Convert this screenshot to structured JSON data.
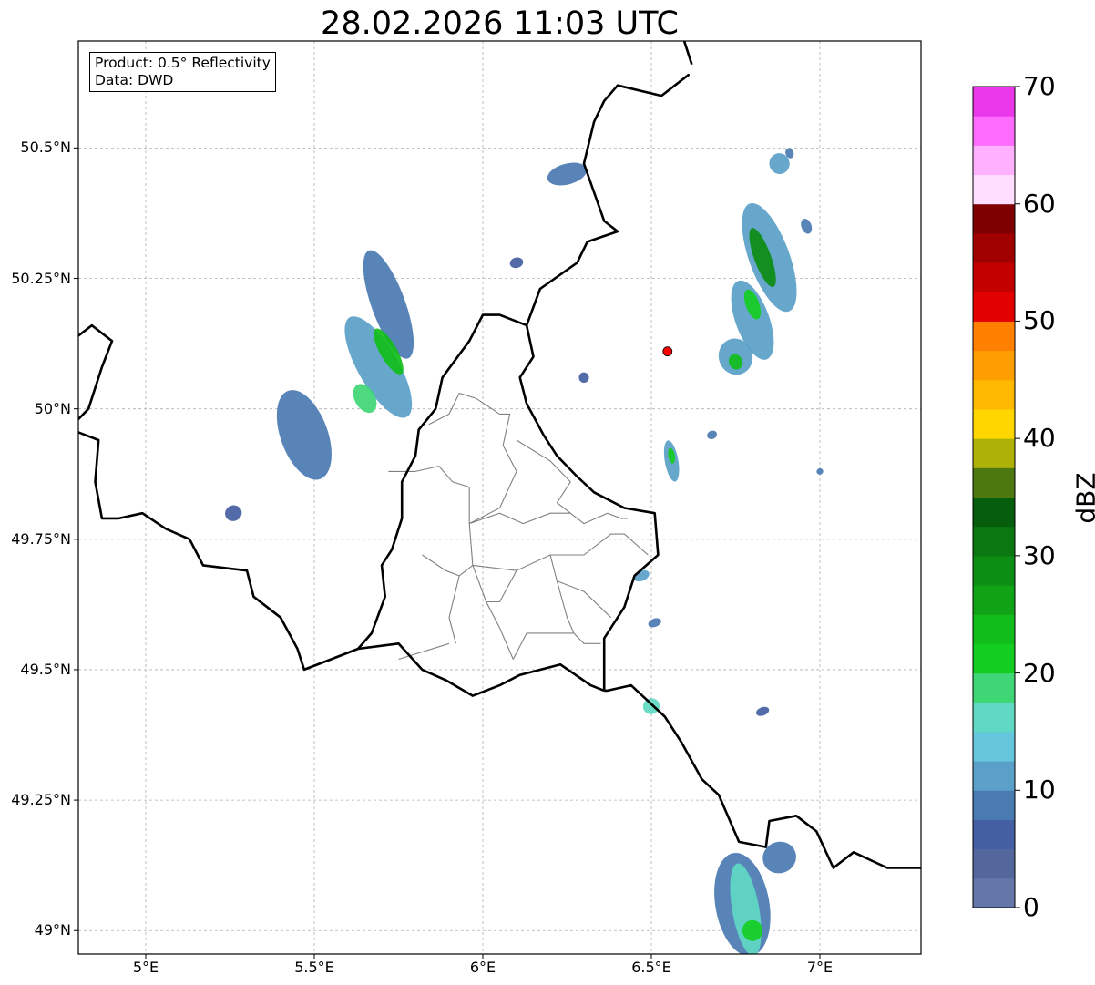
{
  "title": "28.02.2026 11:03 UTC",
  "product_box": {
    "line1": "Product: 0.5° Reflectivity",
    "line2": "Data: DWD"
  },
  "map": {
    "lon_range": [
      4.8,
      7.3
    ],
    "lat_range": [
      48.955,
      50.705
    ],
    "lat_ticks": [
      {
        "value": 50.5,
        "label": "50.5°N"
      },
      {
        "value": 50.25,
        "label": "50.25°N"
      },
      {
        "value": 50.0,
        "label": "50°N"
      },
      {
        "value": 49.75,
        "label": "49.75°N"
      },
      {
        "value": 49.5,
        "label": "49.5°N"
      },
      {
        "value": 49.25,
        "label": "49.25°N"
      },
      {
        "value": 49.0,
        "label": "49°N"
      }
    ],
    "lon_ticks": [
      {
        "value": 5.0,
        "label": "5°E"
      },
      {
        "value": 5.5,
        "label": "5.5°E"
      },
      {
        "value": 6.0,
        "label": "6°E"
      },
      {
        "value": 6.5,
        "label": "6.5°E"
      },
      {
        "value": 7.0,
        "label": "7°E"
      }
    ],
    "grid": true,
    "radar_site": {
      "lon": 6.548,
      "lat": 50.11,
      "color": "#ff0000"
    },
    "echoes": [
      {
        "lon": 5.47,
        "lat": 49.95,
        "rx": 0.07,
        "ry": 0.09,
        "angle": -20,
        "dbz": 8
      },
      {
        "lon": 5.72,
        "lat": 50.2,
        "rx": 0.05,
        "ry": 0.11,
        "angle": -20,
        "dbz": 9
      },
      {
        "lon": 5.69,
        "lat": 50.08,
        "rx": 0.06,
        "ry": 0.11,
        "angle": -30,
        "dbz": 12
      },
      {
        "lon": 5.72,
        "lat": 50.11,
        "rx": 0.025,
        "ry": 0.05,
        "angle": -30,
        "dbz": 24
      },
      {
        "lon": 5.65,
        "lat": 50.02,
        "rx": 0.03,
        "ry": 0.03,
        "angle": -30,
        "dbz": 18
      },
      {
        "lon": 5.26,
        "lat": 49.8,
        "rx": 0.025,
        "ry": 0.015,
        "angle": -20,
        "dbz": 7
      },
      {
        "lon": 6.25,
        "lat": 50.45,
        "rx": 0.06,
        "ry": 0.02,
        "angle": -15,
        "dbz": 8
      },
      {
        "lon": 6.1,
        "lat": 50.28,
        "rx": 0.02,
        "ry": 0.01,
        "angle": -15,
        "dbz": 6
      },
      {
        "lon": 6.3,
        "lat": 50.06,
        "rx": 0.015,
        "ry": 0.01,
        "angle": -15,
        "dbz": 6
      },
      {
        "lon": 6.85,
        "lat": 50.29,
        "rx": 0.06,
        "ry": 0.11,
        "angle": -20,
        "dbz": 10
      },
      {
        "lon": 6.83,
        "lat": 50.29,
        "rx": 0.025,
        "ry": 0.06,
        "angle": -20,
        "dbz": 28
      },
      {
        "lon": 6.8,
        "lat": 50.17,
        "rx": 0.05,
        "ry": 0.08,
        "angle": -20,
        "dbz": 10
      },
      {
        "lon": 6.8,
        "lat": 50.2,
        "rx": 0.02,
        "ry": 0.03,
        "angle": -20,
        "dbz": 22
      },
      {
        "lon": 6.75,
        "lat": 50.1,
        "rx": 0.05,
        "ry": 0.035,
        "angle": -20,
        "dbz": 11
      },
      {
        "lon": 6.75,
        "lat": 50.09,
        "rx": 0.02,
        "ry": 0.015,
        "angle": -20,
        "dbz": 24
      },
      {
        "lon": 6.88,
        "lat": 50.47,
        "rx": 0.03,
        "ry": 0.02,
        "angle": -20,
        "dbz": 11
      },
      {
        "lon": 6.91,
        "lat": 50.49,
        "rx": 0.012,
        "ry": 0.01,
        "angle": -20,
        "dbz": 8
      },
      {
        "lon": 6.96,
        "lat": 50.35,
        "rx": 0.015,
        "ry": 0.015,
        "angle": -20,
        "dbz": 8
      },
      {
        "lon": 6.56,
        "lat": 49.9,
        "rx": 0.02,
        "ry": 0.04,
        "angle": -10,
        "dbz": 12
      },
      {
        "lon": 6.56,
        "lat": 49.91,
        "rx": 0.01,
        "ry": 0.015,
        "angle": -10,
        "dbz": 22
      },
      {
        "lon": 6.47,
        "lat": 49.68,
        "rx": 0.025,
        "ry": 0.01,
        "angle": -20,
        "dbz": 11
      },
      {
        "lon": 6.51,
        "lat": 49.59,
        "rx": 0.02,
        "ry": 0.008,
        "angle": -20,
        "dbz": 8
      },
      {
        "lon": 6.5,
        "lat": 49.43,
        "rx": 0.025,
        "ry": 0.015,
        "angle": -20,
        "dbz": 16
      },
      {
        "lon": 6.83,
        "lat": 49.42,
        "rx": 0.02,
        "ry": 0.008,
        "angle": -20,
        "dbz": 7
      },
      {
        "lon": 6.68,
        "lat": 49.95,
        "rx": 0.015,
        "ry": 0.008,
        "angle": -20,
        "dbz": 9
      },
      {
        "lon": 7.0,
        "lat": 49.88,
        "rx": 0.01,
        "ry": 0.006,
        "angle": -20,
        "dbz": 8
      },
      {
        "lon": 6.77,
        "lat": 49.05,
        "rx": 0.08,
        "ry": 0.1,
        "angle": -10,
        "dbz": 9
      },
      {
        "lon": 6.78,
        "lat": 49.04,
        "rx": 0.04,
        "ry": 0.09,
        "angle": -10,
        "dbz": 15
      },
      {
        "lon": 6.88,
        "lat": 49.14,
        "rx": 0.05,
        "ry": 0.03,
        "angle": -20,
        "dbz": 8
      },
      {
        "lon": 6.8,
        "lat": 49.0,
        "rx": 0.03,
        "ry": 0.02,
        "angle": -10,
        "dbz": 21
      }
    ],
    "borders": [
      [
        [
          4.8,
          50.14
        ],
        [
          4.84,
          50.16
        ],
        [
          4.9,
          50.13
        ],
        [
          4.87,
          50.08
        ],
        [
          4.83,
          50.0
        ],
        [
          4.8,
          49.98
        ]
      ],
      [
        [
          4.8,
          49.955
        ],
        [
          4.86,
          49.94
        ],
        [
          4.85,
          49.86
        ],
        [
          4.87,
          49.79
        ],
        [
          4.92,
          49.79
        ],
        [
          4.99,
          49.8
        ],
        [
          5.06,
          49.77
        ],
        [
          5.13,
          49.75
        ],
        [
          5.17,
          49.7
        ],
        [
          5.3,
          49.69
        ],
        [
          5.32,
          49.64
        ],
        [
          5.4,
          49.6
        ],
        [
          5.45,
          49.54
        ],
        [
          5.47,
          49.5
        ],
        [
          5.55,
          49.52
        ],
        [
          5.63,
          49.54
        ],
        [
          5.75,
          49.55
        ],
        [
          5.82,
          49.5
        ],
        [
          5.89,
          49.48
        ],
        [
          5.97,
          49.45
        ],
        [
          6.05,
          49.47
        ],
        [
          6.11,
          49.49
        ],
        [
          6.23,
          49.51
        ],
        [
          6.32,
          49.47
        ],
        [
          6.36,
          49.46
        ]
      ],
      [
        [
          6.59,
          50.63
        ],
        [
          6.61,
          50.64
        ],
        [
          6.53,
          50.6
        ],
        [
          6.4,
          50.62
        ],
        [
          6.36,
          50.59
        ],
        [
          6.33,
          50.55
        ],
        [
          6.3,
          50.47
        ],
        [
          6.36,
          50.36
        ],
        [
          6.4,
          50.34
        ],
        [
          6.31,
          50.32
        ],
        [
          6.28,
          50.28
        ],
        [
          6.17,
          50.23
        ],
        [
          6.13,
          50.16
        ],
        [
          6.15,
          50.1
        ],
        [
          6.11,
          50.06
        ],
        [
          6.13,
          50.01
        ],
        [
          6.18,
          49.95
        ],
        [
          6.22,
          49.91
        ],
        [
          6.28,
          49.87
        ],
        [
          6.33,
          49.84
        ],
        [
          6.42,
          49.81
        ],
        [
          6.51,
          49.8
        ],
        [
          6.52,
          49.72
        ],
        [
          6.45,
          49.68
        ],
        [
          6.42,
          49.62
        ],
        [
          6.36,
          49.56
        ],
        [
          6.36,
          49.46
        ]
      ],
      [
        [
          6.59,
          50.72
        ],
        [
          6.62,
          50.66
        ]
      ],
      [
        [
          6.36,
          49.46
        ],
        [
          6.37,
          49.46
        ],
        [
          6.44,
          49.47
        ],
        [
          6.54,
          49.41
        ],
        [
          6.59,
          49.36
        ],
        [
          6.65,
          49.29
        ],
        [
          6.7,
          49.26
        ],
        [
          6.76,
          49.17
        ],
        [
          6.84,
          49.16
        ],
        [
          6.85,
          49.21
        ],
        [
          6.93,
          49.22
        ],
        [
          6.99,
          49.19
        ],
        [
          7.04,
          49.12
        ],
        [
          7.1,
          49.15
        ],
        [
          7.2,
          49.12
        ],
        [
          7.3,
          49.12
        ]
      ],
      [
        [
          6.13,
          50.16
        ],
        [
          6.05,
          50.18
        ],
        [
          6.0,
          50.18
        ],
        [
          5.96,
          50.13
        ],
        [
          5.88,
          50.06
        ],
        [
          5.86,
          50.0
        ],
        [
          5.81,
          49.96
        ],
        [
          5.8,
          49.91
        ],
        [
          5.76,
          49.86
        ],
        [
          5.76,
          49.79
        ],
        [
          5.73,
          49.73
        ],
        [
          5.7,
          49.7
        ],
        [
          5.71,
          49.64
        ],
        [
          5.67,
          49.57
        ],
        [
          5.63,
          49.54
        ]
      ]
    ],
    "districts": [
      [
        [
          5.84,
          49.97
        ],
        [
          5.9,
          49.99
        ],
        [
          5.93,
          50.03
        ],
        [
          5.98,
          50.02
        ],
        [
          6.05,
          49.99
        ],
        [
          6.08,
          49.99
        ],
        [
          6.06,
          49.93
        ],
        [
          6.1,
          49.88
        ],
        [
          6.05,
          49.81
        ],
        [
          5.96,
          49.78
        ]
      ],
      [
        [
          5.8,
          49.88
        ],
        [
          5.87,
          49.89
        ],
        [
          5.91,
          49.86
        ],
        [
          5.96,
          49.85
        ],
        [
          5.96,
          49.78
        ]
      ],
      [
        [
          6.1,
          49.94
        ],
        [
          6.2,
          49.9
        ],
        [
          6.26,
          49.86
        ],
        [
          6.22,
          49.82
        ],
        [
          6.26,
          49.8
        ],
        [
          6.3,
          49.78
        ],
        [
          6.37,
          49.8
        ],
        [
          6.41,
          49.79
        ],
        [
          6.43,
          49.79
        ]
      ],
      [
        [
          5.96,
          49.78
        ],
        [
          6.05,
          49.8
        ],
        [
          6.12,
          49.78
        ],
        [
          6.2,
          49.8
        ],
        [
          6.26,
          49.8
        ]
      ],
      [
        [
          5.96,
          49.78
        ],
        [
          5.97,
          49.7
        ],
        [
          5.93,
          49.68
        ],
        [
          5.89,
          49.69
        ],
        [
          5.82,
          49.72
        ]
      ],
      [
        [
          5.97,
          49.7
        ],
        [
          6.1,
          49.69
        ],
        [
          6.2,
          49.72
        ],
        [
          6.3,
          49.72
        ],
        [
          6.38,
          49.76
        ],
        [
          6.42,
          49.76
        ],
        [
          6.49,
          49.72
        ]
      ],
      [
        [
          5.93,
          49.68
        ],
        [
          5.9,
          49.6
        ],
        [
          5.92,
          49.55
        ]
      ],
      [
        [
          5.97,
          49.7
        ],
        [
          6.01,
          49.63
        ],
        [
          6.05,
          49.58
        ],
        [
          6.09,
          49.52
        ]
      ],
      [
        [
          6.1,
          49.69
        ],
        [
          6.05,
          49.63
        ],
        [
          6.01,
          49.63
        ]
      ],
      [
        [
          6.22,
          49.67
        ],
        [
          6.25,
          49.6
        ],
        [
          6.27,
          49.57
        ],
        [
          6.3,
          49.55
        ],
        [
          6.35,
          49.55
        ]
      ],
      [
        [
          6.09,
          49.52
        ],
        [
          6.13,
          49.57
        ],
        [
          6.27,
          49.57
        ]
      ],
      [
        [
          6.2,
          49.72
        ],
        [
          6.22,
          49.67
        ],
        [
          6.3,
          49.65
        ],
        [
          6.38,
          49.6
        ]
      ],
      [
        [
          5.8,
          49.88
        ],
        [
          5.72,
          49.88
        ]
      ],
      [
        [
          5.9,
          49.55
        ],
        [
          5.75,
          49.52
        ]
      ]
    ]
  },
  "colorbar": {
    "label": "dBZ",
    "min": 0,
    "max": 70,
    "ticks": [
      {
        "value": 0,
        "label": "0"
      },
      {
        "value": 10,
        "label": "10"
      },
      {
        "value": 20,
        "label": "20"
      },
      {
        "value": 30,
        "label": "30"
      },
      {
        "value": 40,
        "label": "40"
      },
      {
        "value": 50,
        "label": "50"
      },
      {
        "value": 60,
        "label": "60"
      },
      {
        "value": 70,
        "label": "70"
      }
    ],
    "colors": [
      "#6577a8",
      "#53679d",
      "#4460a2",
      "#4a7ab2",
      "#5aa0c8",
      "#66c6dc",
      "#60d9c4",
      "#3fd676",
      "#13cd21",
      "#11bd1a",
      "#10a316",
      "#0c8d13",
      "#0a7710",
      "#065e0c",
      "#4d7810",
      "#adb108",
      "#ffd600",
      "#ffb900",
      "#ff9e00",
      "#ff7f00",
      "#e30000",
      "#c20000",
      "#a00000",
      "#7f0000",
      "#ffdeff",
      "#ffb1ff",
      "#ff6bff",
      "#ea37ea"
    ]
  }
}
